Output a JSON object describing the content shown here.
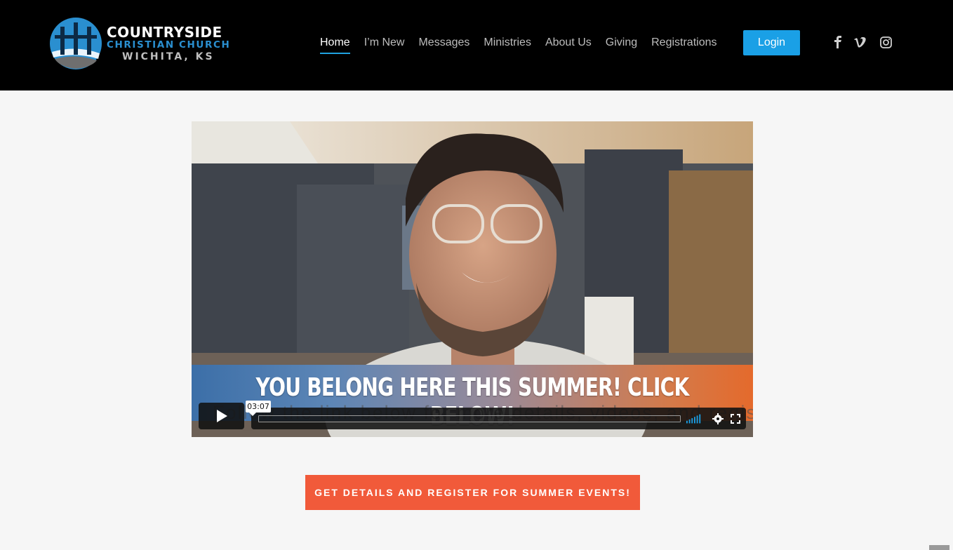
{
  "logo": {
    "line1": "COUNTRYSIDE",
    "line2": "CHRISTIAN CHURCH",
    "line3": "WICHITA, KS"
  },
  "nav": {
    "items": [
      {
        "label": "Home",
        "active": true
      },
      {
        "label": "I’m New"
      },
      {
        "label": "Messages"
      },
      {
        "label": "Ministries"
      },
      {
        "label": "About Us"
      },
      {
        "label": "Giving"
      },
      {
        "label": "Registrations"
      }
    ],
    "login_label": "Login"
  },
  "social": [
    "facebook-icon",
    "vimeo-icon",
    "instagram-icon"
  ],
  "video": {
    "banner": "YOU BELONG HERE THIS SUMMER! CLICK BELOW!",
    "caption": "Follow the link below for more details, videos, and registration!",
    "time": "03:07"
  },
  "cta": {
    "label": "GET DETAILS AND REGISTER FOR SUMMER EVENTS!"
  },
  "colors": {
    "header_bg": "#000000",
    "login_bg": "#1aa0e6",
    "cta_bg": "#f15a3a",
    "page_bg": "#f6f6f6",
    "active_underline": "#1fa2e0"
  }
}
